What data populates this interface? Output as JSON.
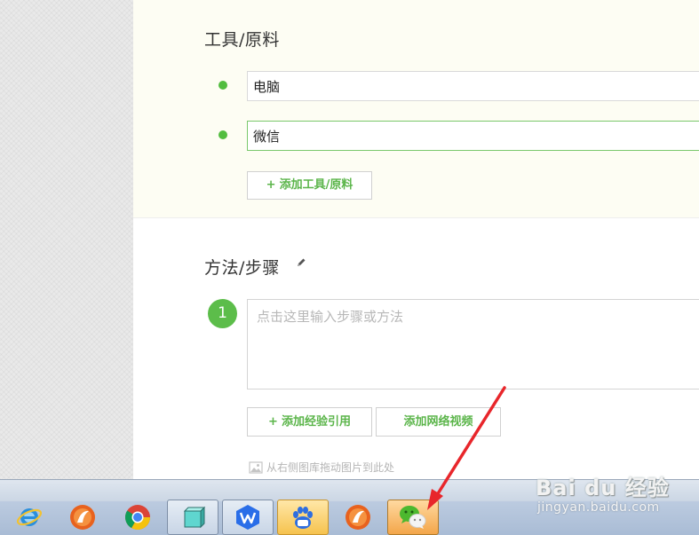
{
  "tools_section": {
    "title": "工具/原料",
    "items": [
      "电脑",
      "微信"
    ],
    "add_button": "添加工具/原料"
  },
  "steps_section": {
    "title": "方法/步骤",
    "edit_icon": "pencil-icon",
    "step_number": "1",
    "step_placeholder": "点击这里输入步骤或方法",
    "add_reference_button": "添加经验引用",
    "add_video_button": "添加网络视频",
    "image_hint": "从右侧图库拖动图片到此处"
  },
  "taskbar": {
    "items": [
      "ie-icon",
      "browser-icon",
      "chrome-icon",
      "cube-icon",
      "wps-icon",
      "baidu-icon",
      "browser-icon",
      "wechat-icon"
    ]
  },
  "watermark": {
    "brand": "Bai du 经验",
    "url": "jingyan.baidu.com"
  },
  "colors": {
    "accent_green": "#52bd3f",
    "annotation_red": "#e8262b"
  }
}
